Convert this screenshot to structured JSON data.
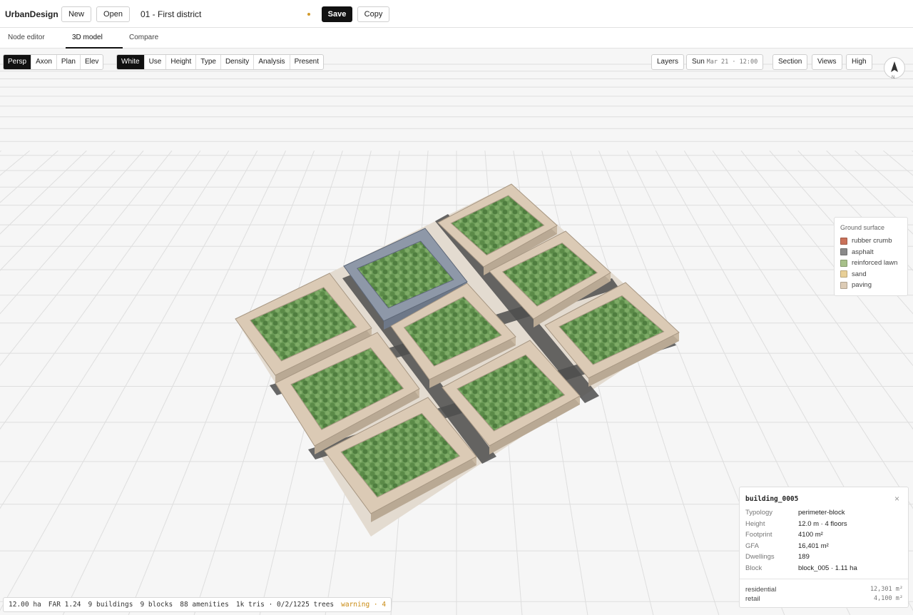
{
  "app": {
    "brand": "UrbanDesign",
    "new_label": "New",
    "open_label": "Open",
    "document_title": "01 - First district",
    "save_label": "Save",
    "copy_label": "Copy"
  },
  "tabs": [
    {
      "label": "Node editor"
    },
    {
      "label": "3D model",
      "active": true
    },
    {
      "label": "Compare"
    }
  ],
  "view_modes": [
    "Persp",
    "Axon",
    "Plan",
    "Elev"
  ],
  "view_mode_selected": "Persp",
  "color_modes": [
    "White",
    "Use",
    "Height",
    "Type",
    "Density",
    "Analysis",
    "Present"
  ],
  "color_mode_selected": "White",
  "right_toolbar": {
    "layers": "Layers",
    "sun_label": "Sun",
    "sun_time": "Mar 21 · 12:00",
    "section": "Section",
    "views": "Views",
    "quality": "High",
    "compass_label": "N"
  },
  "legend": {
    "title": "Ground surface",
    "items": [
      {
        "label": "rubber crumb",
        "color": "#c97159"
      },
      {
        "label": "asphalt",
        "color": "#8a8a8a"
      },
      {
        "label": "reinforced lawn",
        "color": "#a7c08a"
      },
      {
        "label": "sand",
        "color": "#e8cf97"
      },
      {
        "label": "paving",
        "color": "#dccbb5"
      }
    ]
  },
  "info_panel": {
    "title": "building_0005",
    "close": "×",
    "rows": [
      {
        "key": "Typology",
        "value": "perimeter-block"
      },
      {
        "key": "Height",
        "value": "12.0 m · 4 floors"
      },
      {
        "key": "Footprint",
        "value": "4100 m²"
      },
      {
        "key": "GFA",
        "value": "16,401 m²"
      },
      {
        "key": "Dwellings",
        "value": "189"
      },
      {
        "key": "Block",
        "value": "block_005 · 1.11 ha"
      }
    ],
    "uses": [
      {
        "key": "residential",
        "value": "12,301 m²"
      },
      {
        "key": "retail",
        "value": "4,100 m²"
      }
    ]
  },
  "status_bar": {
    "area": "12.00 ha",
    "far": "FAR 1.24",
    "buildings": "9 buildings",
    "blocks": "9 blocks",
    "amenities": "88 amenities",
    "tris": "1k tris · 0/2/1225 trees",
    "warning": "warning · 4"
  },
  "scene": {
    "grid_color": "#dedede",
    "building_color": "#dbcab5",
    "selected_building_color": "#8e98a8",
    "courtyard_color": "#6c9c58"
  }
}
